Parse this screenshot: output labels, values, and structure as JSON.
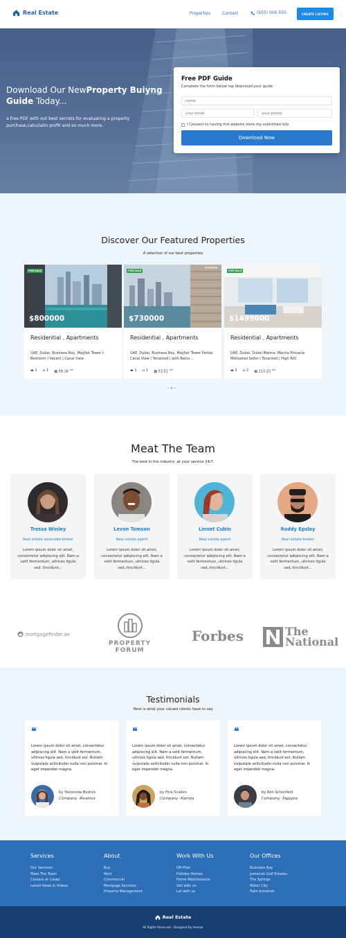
{
  "nav": {
    "logo_text": "Real Estate",
    "links": [
      "Properties",
      "Contact"
    ],
    "phone": "(555) 006 555",
    "cta": "CREATE LISTING"
  },
  "hero": {
    "heading_pre": "Download Our New",
    "heading_bold": "Property Buiyng Guide",
    "heading_post": " Today...",
    "subtext": "a free PDF with out best secrets for evaluating a property purchase,calculatin profit and so much more."
  },
  "lead_form": {
    "title": "Free PDF Guide",
    "description": "Complete the form below top download your guide",
    "name_placeholder": "name",
    "email_placeholder": "your email",
    "phone_placeholder": "your phone",
    "consent": "I Consent to having this website store my submitted info",
    "submit": "Download Now"
  },
  "featured": {
    "title": "Discover Our Featured Properties",
    "subtitle": "A selection of our best properties",
    "badge": "FOR-SALE",
    "properties": [
      {
        "price": "$800000",
        "type": "Residential , Apartments",
        "desc": "UAE, Dubai, Business Bay, Mayfair Tower I-Bedroom | Vacant | Canal View",
        "beds": "1",
        "baths": "1",
        "area": "58.16",
        "area_unit": "m2"
      },
      {
        "price": "$730000",
        "type": "Residential , Apartments",
        "desc": "UAE, Dubai, Business Bay, Mayfair Tower Partial Canal View | Tenanted | with Balco...",
        "beds": "1",
        "baths": "1",
        "area": "53.51",
        "area_unit": "m2"
      },
      {
        "price": "$1499000",
        "type": "Residential , Apartments",
        "desc": "UAE, Dubai, Dubai Marina, Marina Pinnacle Motivated Seller I Tenanted | High ROI",
        "beds": "2",
        "baths": "2",
        "area": "113.25",
        "area_unit": "m2"
      }
    ],
    "card2_overlay": "homes"
  },
  "team": {
    "title": "Meat The Team",
    "subtitle": "The best in the industry ,at your service 24/7.",
    "bio": "Lorem ipsum dolor sit amet, consectetur adipiscing elit. Nam a velit fermentum, ultrices ligula sed, tincidunt...",
    "members": [
      {
        "name": "Tressa Winley",
        "role": "Real estate associate broker"
      },
      {
        "name": "Levon Tomson",
        "role": "Real estate agent"
      },
      {
        "name": "Linnet Cubin",
        "role": "Real estate agent"
      },
      {
        "name": "Roddy Epsley",
        "role": "Real estate broker"
      }
    ]
  },
  "partners": {
    "mortgage": "mortgagefinder.ae",
    "forum_line1": "PROPERTY",
    "forum_line2": "FORUM",
    "forbes": "Forbes",
    "national_the": "The",
    "national_name": "National"
  },
  "testimonials": {
    "title": "Testimonials",
    "subtitle": "Here is what your valued clients have to say",
    "text": "Lorem ipsum dolor sit amet, consectetur adipiscing elit. Nam a velit fermentum, ultrices ligula sed, tincidunt est. Nullam vulputate sollicitudin nulla non pulvinar. In eget imperdiet magna.",
    "items": [
      {
        "by": "by Yovonnda Bostick",
        "company": "Company -Realmix"
      },
      {
        "by": "by Fina Scallon",
        "company": "Company -Kamba"
      },
      {
        "by": "by Ron Schonfeld",
        "company": "Company -Tagopia"
      }
    ]
  },
  "footer": {
    "columns": [
      {
        "heading": "Services",
        "links": [
          "Our Services",
          "Meet The Team",
          "Careers at Casaz",
          "Latest News & Videos"
        ]
      },
      {
        "heading": "About",
        "links": [
          "Buy",
          "Rent",
          "Commercial",
          "Mortgage Services",
          "Property Management"
        ]
      },
      {
        "heading": "Work With Us",
        "links": [
          "Off-Plan",
          "Holiday Homes",
          "Home Maintenance",
          "Sell with us",
          "Let with us"
        ]
      },
      {
        "heading": "Our Offices",
        "links": [
          "Business Bay",
          "Jumeirah Golf Estates",
          "The Springs",
          "Motor City",
          "Palm Jumeirah"
        ]
      }
    ],
    "logo_text": "Real Estate",
    "copyright": "All Rights Reserved - Designed By Ammar"
  },
  "colors": {
    "primary": "#2a7bcf",
    "footer": "#2d6eb9",
    "footer_bottom": "#183d70",
    "section_bg": "#eef5fb",
    "for_sale": "#2e9e49"
  }
}
